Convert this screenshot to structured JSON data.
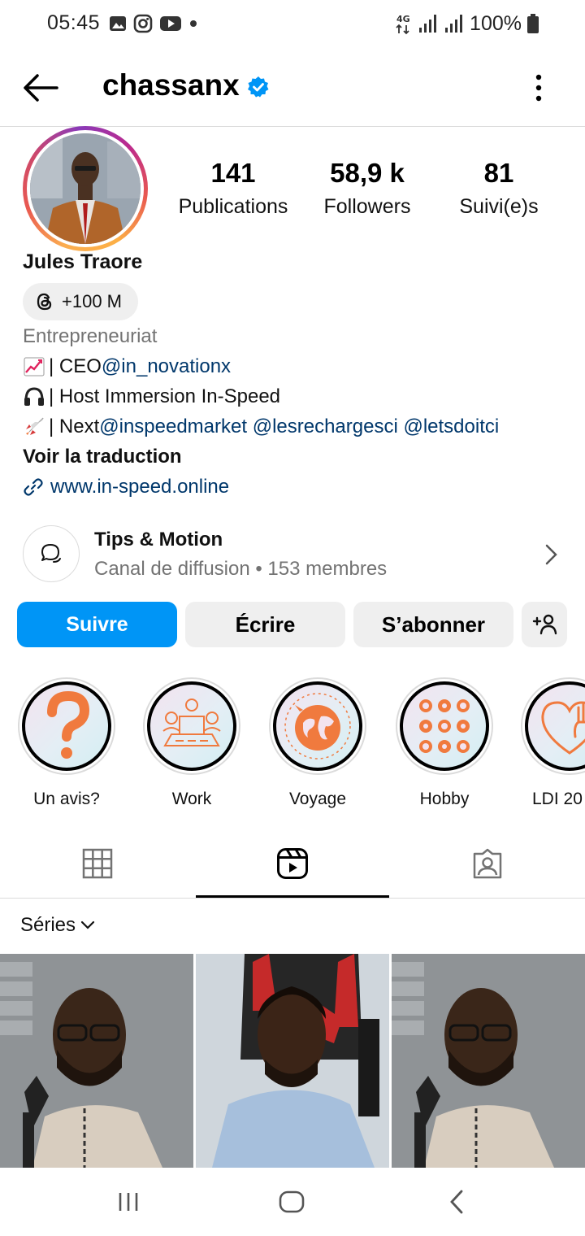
{
  "status_bar": {
    "time": "05:45",
    "network": "4G",
    "battery": "100%",
    "icons": [
      "gallery-icon",
      "instagram-icon",
      "youtube-icon",
      "notification-dot-icon",
      "signal-icon",
      "battery-icon"
    ]
  },
  "header": {
    "username": "chassanx",
    "verified": true
  },
  "profile": {
    "name": "Jules Traore",
    "stats": [
      {
        "value": "141",
        "label": "Publications"
      },
      {
        "value": "58,9 k",
        "label": "Followers"
      },
      {
        "value": "81",
        "label": "Suivi(e)s"
      }
    ],
    "threads_badge": "+100 M",
    "category": "Entrepreneuriat",
    "bio": {
      "line1_text": "| CEO ",
      "line1_mention": "@in_novationx",
      "line2_text": "| Host Immersion In-Speed",
      "line3_text": "| Next ",
      "line3_mentions": "@inspeedmarket @lesrechargesci @letsdoitci"
    },
    "see_translation": "Voir la traduction",
    "website": "www.in-speed.online"
  },
  "channel": {
    "title": "Tips & Motion",
    "subtitle": "Canal de diffusion • 153 membres"
  },
  "buttons": {
    "follow": "Suivre",
    "message": "Écrire",
    "subscribe": "S’abonner"
  },
  "highlights": [
    {
      "label": "Un avis?",
      "icon": "question-mark-icon"
    },
    {
      "label": "Work",
      "icon": "meeting-icon"
    },
    {
      "label": "Voyage",
      "icon": "globe-plane-icon"
    },
    {
      "label": "Hobby",
      "icon": "sports-icon"
    },
    {
      "label": "LDI 20",
      "icon": "heart-hand-icon"
    }
  ],
  "tabs": [
    "grid-icon",
    "reels-icon",
    "tagged-icon"
  ],
  "series_label": "Séries",
  "colors": {
    "accent_blue": "#0095f6",
    "link_blue": "#00376b",
    "secondary_text": "#737373",
    "button_grey": "#efefef",
    "verified_blue": "#0095f6",
    "highlight_orange": "#f07a3e"
  }
}
